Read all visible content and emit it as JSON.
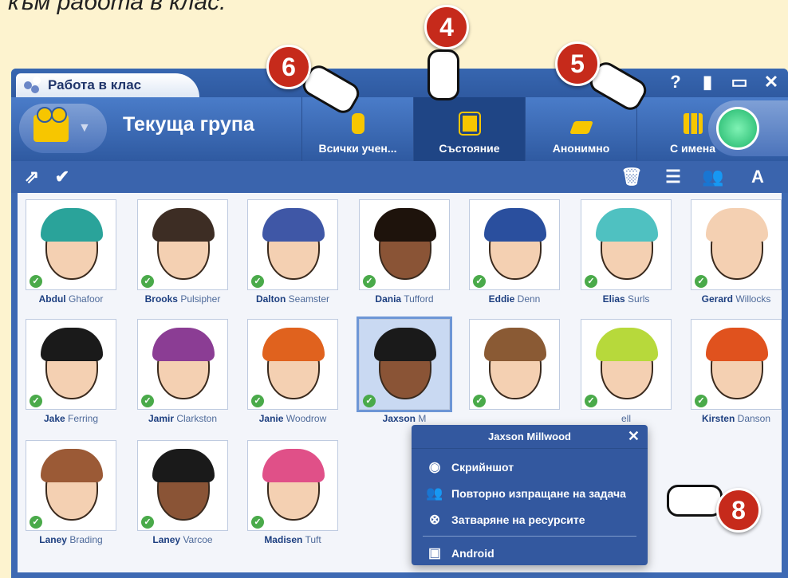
{
  "heading": "към работа в клас.",
  "window": {
    "title": "Работа в клас",
    "controls": [
      "?",
      "▮",
      "▭",
      "✕"
    ]
  },
  "toolbar": {
    "group_label": "Текуща група",
    "segments": [
      {
        "label": "Всички учен...",
        "icon": "traffic-light-icon",
        "color": "#f7c600"
      },
      {
        "label": "Състояние",
        "icon": "student-card-icon",
        "color": "#f7c600"
      },
      {
        "label": "Анонимно",
        "icon": "anonymous-chart-icon",
        "color": "#f7c600"
      },
      {
        "label": "С имена",
        "icon": "bar-chart-icon",
        "color": "#f7c600"
      }
    ]
  },
  "students": [
    {
      "first": "Abdul",
      "last": "Ghafoor",
      "hair": "#2aa39a"
    },
    {
      "first": "Brooks",
      "last": "Pulsipher",
      "hair": "#3d2d24"
    },
    {
      "first": "Dalton",
      "last": "Seamster",
      "hair": "#3f57a6"
    },
    {
      "first": "Dania",
      "last": "Tufford",
      "hair": "#1e130c"
    },
    {
      "first": "Eddie",
      "last": "Denn",
      "hair": "#2a4f9e"
    },
    {
      "first": "Elias",
      "last": "Surls",
      "hair": "#4fc1c1"
    },
    {
      "first": "Gerard",
      "last": "Willocks",
      "hair": "#f4d0b2"
    },
    {
      "first": "Jake",
      "last": "Ferring",
      "hair": "#1a1a1a"
    },
    {
      "first": "Jamir",
      "last": "Clarkston",
      "hair": "#8b3d94"
    },
    {
      "first": "Janie",
      "last": "Woodrow",
      "hair": "#e0621e"
    },
    {
      "first": "Jaxson",
      "last": "M",
      "hair": "#1a1a1a"
    },
    {
      "first": "",
      "last": "",
      "hair": "#8a5a34"
    },
    {
      "first": "",
      "last": "ell",
      "hair": "#b7d93b"
    },
    {
      "first": "Kirsten",
      "last": "Danson",
      "hair": "#e0521e"
    },
    {
      "first": "Laney",
      "last": "Brading",
      "hair": "#9b5a36"
    },
    {
      "first": "Laney",
      "last": "Varcoe",
      "hair": "#1a1a1a"
    },
    {
      "first": "Madisen",
      "last": "Tuft",
      "hair": "#e05088"
    }
  ],
  "popup": {
    "title": "Jaxson Millwood",
    "items": [
      {
        "label": "Скрийншот",
        "icon": "eye-icon"
      },
      {
        "label": "Повторно изпращане на задача",
        "icon": "users-resend-icon"
      },
      {
        "label": "Затваряне на ресурсите",
        "icon": "close-resources-icon"
      },
      {
        "label": "Android",
        "icon": "android-icon"
      }
    ]
  },
  "badges": [
    "6",
    "4",
    "5",
    "8"
  ]
}
